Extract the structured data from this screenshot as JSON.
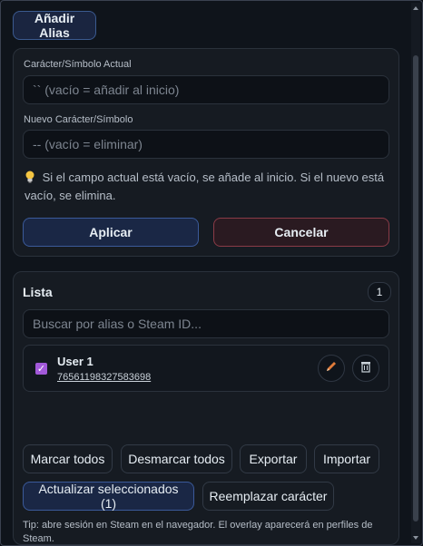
{
  "header": {
    "title_button": "Añadir Alias"
  },
  "alias_form": {
    "current_label": "Carácter/Símbolo Actual",
    "current_placeholder": "`` (vacío = añadir al inicio)",
    "new_label": "Nuevo Carácter/Símbolo",
    "new_placeholder": "-- (vacío = eliminar)",
    "hint_icon": "lightbulb-icon",
    "hint_text": "Si el campo actual está vacío, se añade al inicio. Si el nuevo está vacío, se elimina.",
    "apply_label": "Aplicar",
    "cancel_label": "Cancelar"
  },
  "list": {
    "title": "Lista",
    "count": "1",
    "search_placeholder": "Buscar por alias o Steam ID...",
    "items": [
      {
        "name": "User 1",
        "steam_id": "76561198327583698",
        "checked": true
      }
    ],
    "actions": {
      "mark_all": "Marcar todos",
      "unmark_all": "Desmarcar todos",
      "export": "Exportar",
      "import": "Importar",
      "update_selected": "Actualizar seleccionados (1)",
      "replace_char": "Reemplazar carácter"
    },
    "tip": "Tip: abre sesión en Steam en el navegador. El overlay aparecerá en perfiles de Steam."
  },
  "colors": {
    "accent_blue": "#3b5a9a",
    "cancel_red": "#8a3b47",
    "checkbox_purple": "#a259d9",
    "edit_icon": "#e07b39"
  }
}
